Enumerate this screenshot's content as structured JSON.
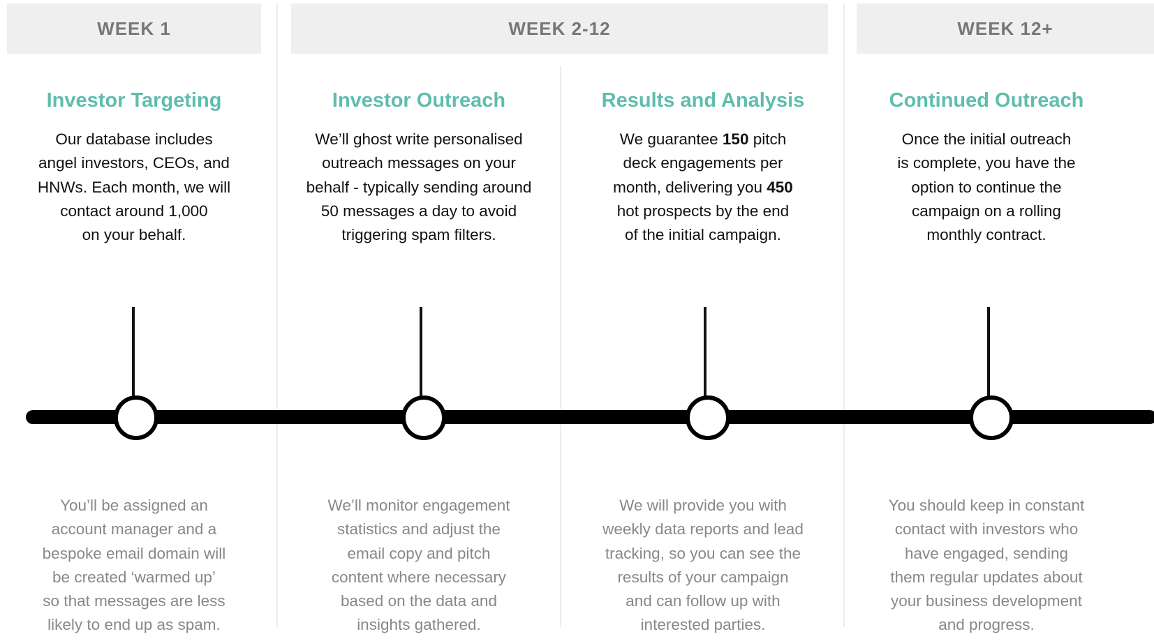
{
  "headers": [
    {
      "label": "WEEK 1"
    },
    {
      "label": "WEEK 2-12"
    },
    {
      "label": "WEEK 12+"
    }
  ],
  "stages": [
    {
      "title": "Investor Targeting",
      "desc_lines": [
        "Our database includes",
        "angel investors, CEOs, and",
        "HNWs. Each month, we will",
        "contact around 1,000",
        "on your behalf."
      ],
      "bottom_lines": [
        "You’ll be assigned an",
        "account manager and a",
        "bespoke email domain will",
        "be created ‘warmed up’",
        "so that messages are less",
        "likely to end up as spam."
      ]
    },
    {
      "title": "Investor Outreach",
      "desc_lines": [
        "We’ll ghost write personalised",
        "outreach messages on your",
        "behalf - typically sending around",
        "50 messages a day to avoid",
        "triggering spam filters."
      ],
      "bottom_lines": [
        "We’ll monitor engagement",
        "statistics and adjust the",
        "email copy and pitch",
        "content where necessary",
        "based on the data and",
        "insights gathered."
      ]
    },
    {
      "title": "Results and Analysis",
      "desc_lines": [
        [
          "We guarantee ",
          "150",
          " pitch"
        ],
        [
          "deck engagements per"
        ],
        [
          "month, delivering you ",
          "450"
        ],
        [
          "hot prospects by the end"
        ],
        [
          "of the initial campaign."
        ]
      ],
      "bottom_lines": [
        "We will provide you with",
        "weekly data reports and lead",
        "tracking, so you can see the",
        "results of your campaign",
        "and can follow up with",
        "interested parties."
      ]
    },
    {
      "title": "Continued Outreach",
      "desc_lines": [
        "Once the initial outreach",
        "is complete, you have the",
        "option to continue the",
        "campaign on a rolling",
        "monthly contract."
      ],
      "bottom_lines": [
        "You should keep in constant",
        "contact with investors who",
        "have engaged, sending",
        "them regular updates about",
        "your business development",
        "and progress."
      ]
    }
  ],
  "colors": {
    "title": "#5fbdad",
    "header_bg": "#efefef",
    "header_text": "#777777",
    "bottom_text": "#888888",
    "timeline": "#000000"
  }
}
